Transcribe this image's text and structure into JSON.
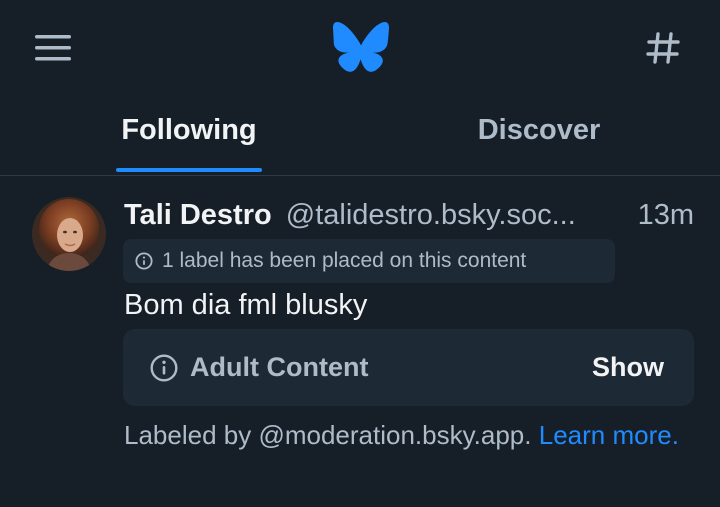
{
  "header": {
    "menu_icon": "hamburger-menu-icon",
    "logo_icon": "butterfly-logo-icon",
    "feeds_icon": "hashtag-icon",
    "accent_color": "#208bfe"
  },
  "tabs": [
    {
      "label": "Following",
      "active": true
    },
    {
      "label": "Discover",
      "active": false
    }
  ],
  "post": {
    "author_name": "Tali Destro",
    "author_handle": "@talidestro.bsky.soc...",
    "time": "13m",
    "label_notice": "1 label has been placed on this content",
    "text": "Bom dia fml blusky",
    "content_warning": {
      "label": "Adult Content",
      "action": "Show"
    },
    "labeled_by_prefix": "Labeled by @moderation.bsky.app.",
    "learn_more": "Learn more."
  }
}
